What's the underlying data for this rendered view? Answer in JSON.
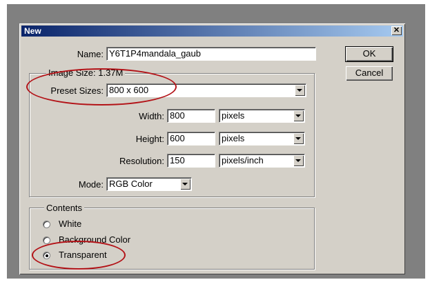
{
  "dialog": {
    "title": "New",
    "close_glyph": "✕"
  },
  "name": {
    "label": "Name:",
    "value": "Y6T1P4mandala_gaub"
  },
  "buttons": {
    "ok": "OK",
    "cancel": "Cancel"
  },
  "image_size": {
    "label": "Image Size: 1.37M"
  },
  "preset": {
    "label": "Preset Sizes:",
    "value": "800 x 600"
  },
  "width": {
    "label": "Width:",
    "value": "800",
    "unit": "pixels"
  },
  "height": {
    "label": "Height:",
    "value": "600",
    "unit": "pixels"
  },
  "resolution": {
    "label": "Resolution:",
    "value": "150",
    "unit": "pixels/inch"
  },
  "mode": {
    "label": "Mode:",
    "value": "RGB Color"
  },
  "contents": {
    "label": "Contents",
    "options": [
      "White",
      "Background Color",
      "Transparent"
    ],
    "selected": "Transparent"
  },
  "annotation_color": "#b31217"
}
